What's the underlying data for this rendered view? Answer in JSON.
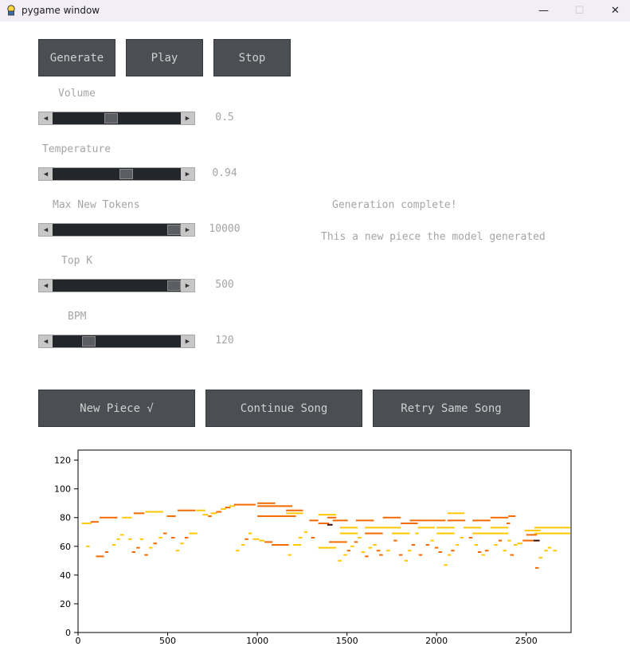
{
  "window": {
    "title": "pygame window",
    "minimize": "—",
    "maximize": "☐",
    "close": "✕"
  },
  "top_buttons": {
    "generate": "Generate",
    "play": "Play",
    "stop": "Stop"
  },
  "sliders": [
    {
      "label": "Volume",
      "value_text": "0.5",
      "level": 0.45
    },
    {
      "label": "Temperature",
      "value_text": "0.94",
      "level": 0.58
    },
    {
      "label": "Max New Tokens",
      "value_text": "10000",
      "level": 1.0
    },
    {
      "label": "Top K",
      "value_text": "500",
      "level": 1.0
    },
    {
      "label": "BPM",
      "value_text": "120",
      "level": 0.26
    }
  ],
  "status": {
    "line1": "Generation complete!",
    "line2": "This a new piece the model generated"
  },
  "bottom_buttons": {
    "new_piece": "New Piece √",
    "continue_song": "Continue Song",
    "retry_same_song": "Retry Same Song"
  },
  "colors": {
    "button_bg": "#4b4e52",
    "slider_track": "#23272b",
    "note_orange": "#f46a00",
    "note_yellow": "#ffc800",
    "note_dark": "#3a0a00"
  },
  "chart_data": {
    "type": "scatter",
    "title": "",
    "xlabel": "",
    "ylabel": "",
    "xlim": [
      0,
      2750
    ],
    "ylim": [
      0,
      127
    ],
    "x_ticks": [
      "0",
      "500",
      "1000",
      "1500",
      "2000",
      "2500"
    ],
    "y_ticks": [
      "0",
      "20",
      "40",
      "60",
      "80",
      "100",
      "120"
    ],
    "notes": [
      {
        "start": 20,
        "end": 75,
        "pitch": 76,
        "vel": "yellow"
      },
      {
        "start": 70,
        "end": 115,
        "pitch": 77,
        "vel": "orange"
      },
      {
        "start": 45,
        "end": 65,
        "pitch": 60,
        "vel": "yellow"
      },
      {
        "start": 100,
        "end": 145,
        "pitch": 53,
        "vel": "orange"
      },
      {
        "start": 120,
        "end": 220,
        "pitch": 80,
        "vel": "orange"
      },
      {
        "start": 150,
        "end": 170,
        "pitch": 56,
        "vel": "orange"
      },
      {
        "start": 190,
        "end": 210,
        "pitch": 61,
        "vel": "yellow"
      },
      {
        "start": 215,
        "end": 235,
        "pitch": 65,
        "vel": "yellow"
      },
      {
        "start": 235,
        "end": 255,
        "pitch": 68,
        "vel": "yellow"
      },
      {
        "start": 245,
        "end": 300,
        "pitch": 80,
        "vel": "yellow"
      },
      {
        "start": 280,
        "end": 300,
        "pitch": 65,
        "vel": "yellow"
      },
      {
        "start": 300,
        "end": 320,
        "pitch": 56,
        "vel": "orange"
      },
      {
        "start": 310,
        "end": 370,
        "pitch": 83,
        "vel": "orange"
      },
      {
        "start": 325,
        "end": 345,
        "pitch": 59,
        "vel": "orange"
      },
      {
        "start": 345,
        "end": 365,
        "pitch": 65,
        "vel": "yellow"
      },
      {
        "start": 370,
        "end": 390,
        "pitch": 54,
        "vel": "orange"
      },
      {
        "start": 375,
        "end": 475,
        "pitch": 84,
        "vel": "yellow"
      },
      {
        "start": 395,
        "end": 415,
        "pitch": 59,
        "vel": "yellow"
      },
      {
        "start": 420,
        "end": 440,
        "pitch": 62,
        "vel": "orange"
      },
      {
        "start": 450,
        "end": 470,
        "pitch": 66,
        "vel": "yellow"
      },
      {
        "start": 475,
        "end": 495,
        "pitch": 69,
        "vel": "orange"
      },
      {
        "start": 495,
        "end": 545,
        "pitch": 81,
        "vel": "orange"
      },
      {
        "start": 520,
        "end": 540,
        "pitch": 66,
        "vel": "orange"
      },
      {
        "start": 545,
        "end": 565,
        "pitch": 57,
        "vel": "yellow"
      },
      {
        "start": 555,
        "end": 655,
        "pitch": 85,
        "vel": "orange"
      },
      {
        "start": 570,
        "end": 590,
        "pitch": 62,
        "vel": "yellow"
      },
      {
        "start": 595,
        "end": 615,
        "pitch": 66,
        "vel": "orange"
      },
      {
        "start": 620,
        "end": 665,
        "pitch": 69,
        "vel": "yellow"
      },
      {
        "start": 660,
        "end": 710,
        "pitch": 85,
        "vel": "yellow"
      },
      {
        "start": 695,
        "end": 725,
        "pitch": 82,
        "vel": "yellow"
      },
      {
        "start": 725,
        "end": 745,
        "pitch": 81,
        "vel": "orange"
      },
      {
        "start": 740,
        "end": 775,
        "pitch": 83,
        "vel": "yellow"
      },
      {
        "start": 770,
        "end": 800,
        "pitch": 84,
        "vel": "orange"
      },
      {
        "start": 795,
        "end": 825,
        "pitch": 86,
        "vel": "yellow"
      },
      {
        "start": 820,
        "end": 850,
        "pitch": 87,
        "vel": "orange"
      },
      {
        "start": 845,
        "end": 875,
        "pitch": 88,
        "vel": "yellow"
      },
      {
        "start": 870,
        "end": 895,
        "pitch": 89,
        "vel": "orange"
      },
      {
        "start": 880,
        "end": 900,
        "pitch": 57,
        "vel": "yellow"
      },
      {
        "start": 890,
        "end": 990,
        "pitch": 89,
        "vel": "orange"
      },
      {
        "start": 910,
        "end": 930,
        "pitch": 61,
        "vel": "yellow"
      },
      {
        "start": 930,
        "end": 950,
        "pitch": 65,
        "vel": "orange"
      },
      {
        "start": 950,
        "end": 970,
        "pitch": 69,
        "vel": "yellow"
      },
      {
        "start": 975,
        "end": 1010,
        "pitch": 65,
        "vel": "yellow"
      },
      {
        "start": 1000,
        "end": 1100,
        "pitch": 90,
        "vel": "orange"
      },
      {
        "start": 1000,
        "end": 1195,
        "pitch": 88,
        "vel": "orange"
      },
      {
        "start": 1000,
        "end": 1215,
        "pitch": 81,
        "vel": "orange"
      },
      {
        "start": 1010,
        "end": 1040,
        "pitch": 64,
        "vel": "yellow"
      },
      {
        "start": 1040,
        "end": 1085,
        "pitch": 63,
        "vel": "orange"
      },
      {
        "start": 1080,
        "end": 1175,
        "pitch": 61,
        "vel": "orange"
      },
      {
        "start": 1160,
        "end": 1255,
        "pitch": 85,
        "vel": "orange"
      },
      {
        "start": 1160,
        "end": 1255,
        "pitch": 83,
        "vel": "yellow"
      },
      {
        "start": 1170,
        "end": 1190,
        "pitch": 54,
        "vel": "yellow"
      },
      {
        "start": 1200,
        "end": 1245,
        "pitch": 61,
        "vel": "yellow"
      },
      {
        "start": 1230,
        "end": 1250,
        "pitch": 66,
        "vel": "yellow"
      },
      {
        "start": 1260,
        "end": 1280,
        "pitch": 70,
        "vel": "yellow"
      },
      {
        "start": 1290,
        "end": 1340,
        "pitch": 78,
        "vel": "orange"
      },
      {
        "start": 1300,
        "end": 1320,
        "pitch": 66,
        "vel": "orange"
      },
      {
        "start": 1340,
        "end": 1440,
        "pitch": 82,
        "vel": "yellow"
      },
      {
        "start": 1340,
        "end": 1440,
        "pitch": 59,
        "vel": "yellow"
      },
      {
        "start": 1340,
        "end": 1400,
        "pitch": 76,
        "vel": "orange"
      },
      {
        "start": 1390,
        "end": 1420,
        "pitch": 75,
        "vel": "dark"
      },
      {
        "start": 1390,
        "end": 1440,
        "pitch": 80,
        "vel": "orange"
      },
      {
        "start": 1400,
        "end": 1500,
        "pitch": 63,
        "vel": "orange"
      },
      {
        "start": 1420,
        "end": 1505,
        "pitch": 78,
        "vel": "orange"
      },
      {
        "start": 1450,
        "end": 1470,
        "pitch": 50,
        "vel": "yellow"
      },
      {
        "start": 1460,
        "end": 1560,
        "pitch": 73,
        "vel": "yellow"
      },
      {
        "start": 1460,
        "end": 1560,
        "pitch": 69,
        "vel": "yellow"
      },
      {
        "start": 1480,
        "end": 1500,
        "pitch": 54,
        "vel": "yellow"
      },
      {
        "start": 1500,
        "end": 1520,
        "pitch": 57,
        "vel": "orange"
      },
      {
        "start": 1520,
        "end": 1540,
        "pitch": 60,
        "vel": "yellow"
      },
      {
        "start": 1540,
        "end": 1560,
        "pitch": 63,
        "vel": "orange"
      },
      {
        "start": 1550,
        "end": 1650,
        "pitch": 78,
        "vel": "orange"
      },
      {
        "start": 1560,
        "end": 1580,
        "pitch": 66,
        "vel": "yellow"
      },
      {
        "start": 1580,
        "end": 1600,
        "pitch": 56,
        "vel": "yellow"
      },
      {
        "start": 1600,
        "end": 1620,
        "pitch": 53,
        "vel": "orange"
      },
      {
        "start": 1600,
        "end": 1700,
        "pitch": 73,
        "vel": "yellow"
      },
      {
        "start": 1600,
        "end": 1700,
        "pitch": 69,
        "vel": "orange"
      },
      {
        "start": 1620,
        "end": 1640,
        "pitch": 59,
        "vel": "yellow"
      },
      {
        "start": 1645,
        "end": 1665,
        "pitch": 61,
        "vel": "yellow"
      },
      {
        "start": 1665,
        "end": 1685,
        "pitch": 57,
        "vel": "orange"
      },
      {
        "start": 1680,
        "end": 1700,
        "pitch": 54,
        "vel": "orange"
      },
      {
        "start": 1700,
        "end": 1800,
        "pitch": 80,
        "vel": "orange"
      },
      {
        "start": 1700,
        "end": 1800,
        "pitch": 73,
        "vel": "yellow"
      },
      {
        "start": 1720,
        "end": 1740,
        "pitch": 57,
        "vel": "yellow"
      },
      {
        "start": 1750,
        "end": 1850,
        "pitch": 69,
        "vel": "yellow"
      },
      {
        "start": 1760,
        "end": 1780,
        "pitch": 64,
        "vel": "orange"
      },
      {
        "start": 1790,
        "end": 1810,
        "pitch": 54,
        "vel": "orange"
      },
      {
        "start": 1800,
        "end": 1895,
        "pitch": 76,
        "vel": "orange"
      },
      {
        "start": 1820,
        "end": 1840,
        "pitch": 50,
        "vel": "yellow"
      },
      {
        "start": 1840,
        "end": 1860,
        "pitch": 57,
        "vel": "yellow"
      },
      {
        "start": 1850,
        "end": 1950,
        "pitch": 78,
        "vel": "orange"
      },
      {
        "start": 1860,
        "end": 1880,
        "pitch": 61,
        "vel": "orange"
      },
      {
        "start": 1880,
        "end": 1900,
        "pitch": 69,
        "vel": "yellow"
      },
      {
        "start": 1895,
        "end": 1990,
        "pitch": 73,
        "vel": "yellow"
      },
      {
        "start": 1900,
        "end": 1920,
        "pitch": 54,
        "vel": "orange"
      },
      {
        "start": 1940,
        "end": 1960,
        "pitch": 61,
        "vel": "orange"
      },
      {
        "start": 1950,
        "end": 2050,
        "pitch": 78,
        "vel": "orange"
      },
      {
        "start": 1965,
        "end": 1985,
        "pitch": 64,
        "vel": "yellow"
      },
      {
        "start": 1990,
        "end": 2010,
        "pitch": 59,
        "vel": "orange"
      },
      {
        "start": 2000,
        "end": 2100,
        "pitch": 73,
        "vel": "yellow"
      },
      {
        "start": 2000,
        "end": 2100,
        "pitch": 69,
        "vel": "yellow"
      },
      {
        "start": 2010,
        "end": 2030,
        "pitch": 56,
        "vel": "orange"
      },
      {
        "start": 2040,
        "end": 2060,
        "pitch": 47,
        "vel": "yellow"
      },
      {
        "start": 2060,
        "end": 2080,
        "pitch": 54,
        "vel": "yellow"
      },
      {
        "start": 2060,
        "end": 2155,
        "pitch": 83,
        "vel": "yellow"
      },
      {
        "start": 2060,
        "end": 2160,
        "pitch": 78,
        "vel": "orange"
      },
      {
        "start": 2080,
        "end": 2100,
        "pitch": 57,
        "vel": "orange"
      },
      {
        "start": 2105,
        "end": 2125,
        "pitch": 61,
        "vel": "yellow"
      },
      {
        "start": 2130,
        "end": 2150,
        "pitch": 66,
        "vel": "yellow"
      },
      {
        "start": 2150,
        "end": 2250,
        "pitch": 73,
        "vel": "yellow"
      },
      {
        "start": 2180,
        "end": 2200,
        "pitch": 66,
        "vel": "orange"
      },
      {
        "start": 2200,
        "end": 2300,
        "pitch": 78,
        "vel": "orange"
      },
      {
        "start": 2200,
        "end": 2300,
        "pitch": 69,
        "vel": "yellow"
      },
      {
        "start": 2210,
        "end": 2230,
        "pitch": 61,
        "vel": "yellow"
      },
      {
        "start": 2230,
        "end": 2250,
        "pitch": 56,
        "vel": "orange"
      },
      {
        "start": 2250,
        "end": 2270,
        "pitch": 54,
        "vel": "yellow"
      },
      {
        "start": 2270,
        "end": 2290,
        "pitch": 57,
        "vel": "orange"
      },
      {
        "start": 2300,
        "end": 2400,
        "pitch": 80,
        "vel": "orange"
      },
      {
        "start": 2300,
        "end": 2400,
        "pitch": 73,
        "vel": "yellow"
      },
      {
        "start": 2300,
        "end": 2400,
        "pitch": 69,
        "vel": "yellow"
      },
      {
        "start": 2320,
        "end": 2340,
        "pitch": 61,
        "vel": "yellow"
      },
      {
        "start": 2345,
        "end": 2365,
        "pitch": 64,
        "vel": "orange"
      },
      {
        "start": 2370,
        "end": 2390,
        "pitch": 57,
        "vel": "yellow"
      },
      {
        "start": 2390,
        "end": 2410,
        "pitch": 76,
        "vel": "orange"
      },
      {
        "start": 2395,
        "end": 2415,
        "pitch": 64,
        "vel": "yellow"
      },
      {
        "start": 2400,
        "end": 2440,
        "pitch": 81,
        "vel": "orange"
      },
      {
        "start": 2410,
        "end": 2430,
        "pitch": 54,
        "vel": "orange"
      },
      {
        "start": 2430,
        "end": 2450,
        "pitch": 61,
        "vel": "yellow"
      },
      {
        "start": 2450,
        "end": 2480,
        "pitch": 62,
        "vel": "yellow"
      },
      {
        "start": 2480,
        "end": 2540,
        "pitch": 64,
        "vel": "orange"
      },
      {
        "start": 2490,
        "end": 2580,
        "pitch": 71,
        "vel": "yellow"
      },
      {
        "start": 2500,
        "end": 2560,
        "pitch": 68,
        "vel": "orange"
      },
      {
        "start": 2540,
        "end": 2575,
        "pitch": 64,
        "vel": "dark"
      },
      {
        "start": 2545,
        "end": 2745,
        "pitch": 73,
        "vel": "yellow"
      },
      {
        "start": 2545,
        "end": 2745,
        "pitch": 69,
        "vel": "yellow"
      },
      {
        "start": 2550,
        "end": 2570,
        "pitch": 45,
        "vel": "orange"
      },
      {
        "start": 2570,
        "end": 2590,
        "pitch": 52,
        "vel": "yellow"
      },
      {
        "start": 2600,
        "end": 2620,
        "pitch": 57,
        "vel": "yellow"
      },
      {
        "start": 2620,
        "end": 2640,
        "pitch": 59,
        "vel": "yellow"
      },
      {
        "start": 2650,
        "end": 2670,
        "pitch": 57,
        "vel": "yellow"
      }
    ]
  }
}
